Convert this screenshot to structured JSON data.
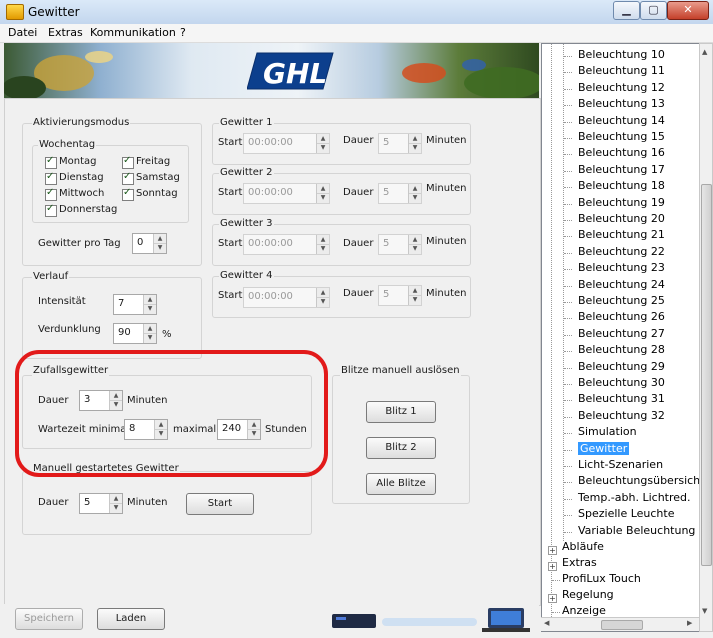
{
  "window": {
    "title": "Gewitter"
  },
  "menu": [
    "Datei",
    "Extras",
    "Kommunikation",
    "?"
  ],
  "logo": "GHL",
  "aktivierungsmodus": {
    "label": "Aktivierungsmodus",
    "wochentag_label": "Wochentag",
    "days": [
      "Montag",
      "Freitag",
      "Dienstag",
      "Samstag",
      "Mittwoch",
      "Sonntag",
      "Donnerstag"
    ],
    "gewitter_pro_tag_label": "Gewitter pro Tag",
    "gewitter_pro_tag_value": "0"
  },
  "gewitter_slots": [
    {
      "title": "Gewitter 1",
      "start_label": "Start",
      "start_value": "00:00:00",
      "dauer_label": "Dauer",
      "dauer_value": "5",
      "unit": "Minuten"
    },
    {
      "title": "Gewitter 2",
      "start_label": "Start",
      "start_value": "00:00:00",
      "dauer_label": "Dauer",
      "dauer_value": "5",
      "unit": "Minuten"
    },
    {
      "title": "Gewitter 3",
      "start_label": "Start",
      "start_value": "00:00:00",
      "dauer_label": "Dauer",
      "dauer_value": "5",
      "unit": "Minuten"
    },
    {
      "title": "Gewitter 4",
      "start_label": "Start",
      "start_value": "00:00:00",
      "dauer_label": "Dauer",
      "dauer_value": "5",
      "unit": "Minuten"
    }
  ],
  "verlauf": {
    "label": "Verlauf",
    "intensitaet_label": "Intensität",
    "intensitaet_value": "7",
    "verdunklung_label": "Verdunklung",
    "verdunklung_value": "90",
    "verdunklung_unit": "%"
  },
  "zufall": {
    "label": "Zufallsgewitter",
    "dauer_label": "Dauer",
    "dauer_value": "3",
    "dauer_unit": "Minuten",
    "wartezeit_label": "Wartezeit minimal",
    "wartezeit_min": "8",
    "maximal_label": "maximal",
    "wartezeit_max": "240",
    "wartezeit_unit": "Stunden"
  },
  "blitze": {
    "label": "Blitze manuell auslösen",
    "buttons": [
      "Blitz 1",
      "Blitz 2",
      "Alle Blitze"
    ]
  },
  "manuell": {
    "label": "Manuell gestartetes Gewitter",
    "dauer_label": "Dauer",
    "dauer_value": "5",
    "unit": "Minuten",
    "start_button": "Start"
  },
  "footer": {
    "speichern": "Speichern",
    "laden": "Laden"
  },
  "tree": {
    "items": [
      "Beleuchtung 10",
      "Beleuchtung 11",
      "Beleuchtung 12",
      "Beleuchtung 13",
      "Beleuchtung 14",
      "Beleuchtung 15",
      "Beleuchtung 16",
      "Beleuchtung 17",
      "Beleuchtung 18",
      "Beleuchtung 19",
      "Beleuchtung 20",
      "Beleuchtung 21",
      "Beleuchtung 22",
      "Beleuchtung 23",
      "Beleuchtung 24",
      "Beleuchtung 25",
      "Beleuchtung 26",
      "Beleuchtung 27",
      "Beleuchtung 28",
      "Beleuchtung 29",
      "Beleuchtung 30",
      "Beleuchtung 31",
      "Beleuchtung 32",
      "Simulation",
      "Gewitter",
      "Licht-Szenarien",
      "Beleuchtungsübersicht",
      "Temp.-abh. Lichtred.",
      "Spezielle Leuchte",
      "Variable Beleuchtung"
    ],
    "selected": "Gewitter",
    "top_nodes": [
      "Abläufe",
      "Extras",
      "ProfiLux Touch",
      "Regelung",
      "Anzeige"
    ]
  }
}
